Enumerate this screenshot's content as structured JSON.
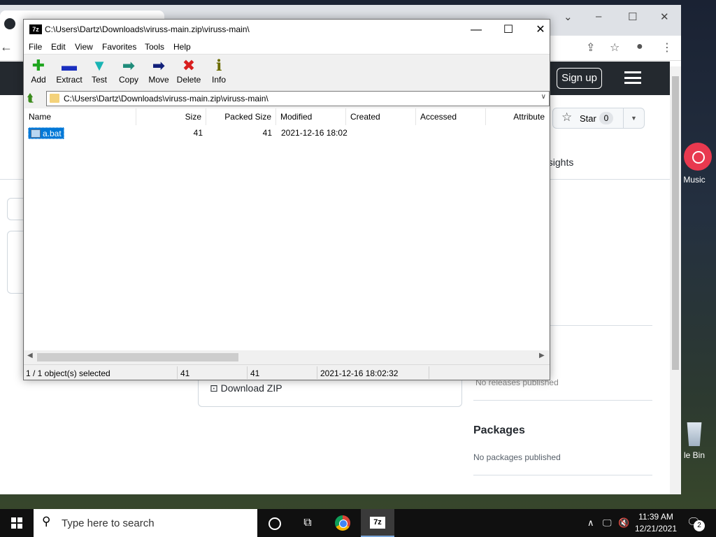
{
  "desktop": {
    "music_label": "Music",
    "bin_label": "le Bin"
  },
  "browser": {
    "controls": {
      "minimize": "–",
      "maximize": "☐",
      "close": "✕"
    },
    "signup_label": "Sign up",
    "star_label": "Star",
    "star_count": "0",
    "insights_label": "nsights",
    "download_zip_label": "Download ZIP",
    "released_text": "No releases published",
    "packages_heading": "Packages",
    "packages_text": "No packages published"
  },
  "sevenzip": {
    "title": "C:\\Users\\Dartz\\Downloads\\viruss-main.zip\\viruss-main\\",
    "icon_label": "7z",
    "menu": [
      "File",
      "Edit",
      "View",
      "Favorites",
      "Tools",
      "Help"
    ],
    "toolbar": [
      {
        "label": "Add",
        "glyph": "✚",
        "color": "#1fa51f"
      },
      {
        "label": "Extract",
        "glyph": "▬",
        "color": "#1a2fbf"
      },
      {
        "label": "Test",
        "glyph": "▼",
        "color": "#19b4b4"
      },
      {
        "label": "Copy",
        "glyph": "➡",
        "color": "#1f8c7a"
      },
      {
        "label": "Move",
        "glyph": "➡",
        "color": "#12207a"
      },
      {
        "label": "Delete",
        "glyph": "✖",
        "color": "#d81e1e"
      },
      {
        "label": "Info",
        "glyph": "ℹ",
        "color": "#6b6b00"
      }
    ],
    "path": "C:\\Users\\Dartz\\Downloads\\viruss-main.zip\\viruss-main\\",
    "columns": [
      "Name",
      "Size",
      "Packed Size",
      "Modified",
      "Created",
      "Accessed",
      "Attribute"
    ],
    "files": [
      {
        "name": "a.bat",
        "size": "41",
        "packed": "41",
        "modified": "2021-12-16 18:02",
        "created": "",
        "accessed": ""
      }
    ],
    "status": {
      "selection": "1 / 1 object(s) selected",
      "size": "41",
      "packed": "41",
      "modified": "2021-12-16 18:02:32"
    }
  },
  "taskbar": {
    "search_placeholder": "Type here to search",
    "time": "11:39 AM",
    "date": "12/21/2021",
    "notifications": "2"
  }
}
